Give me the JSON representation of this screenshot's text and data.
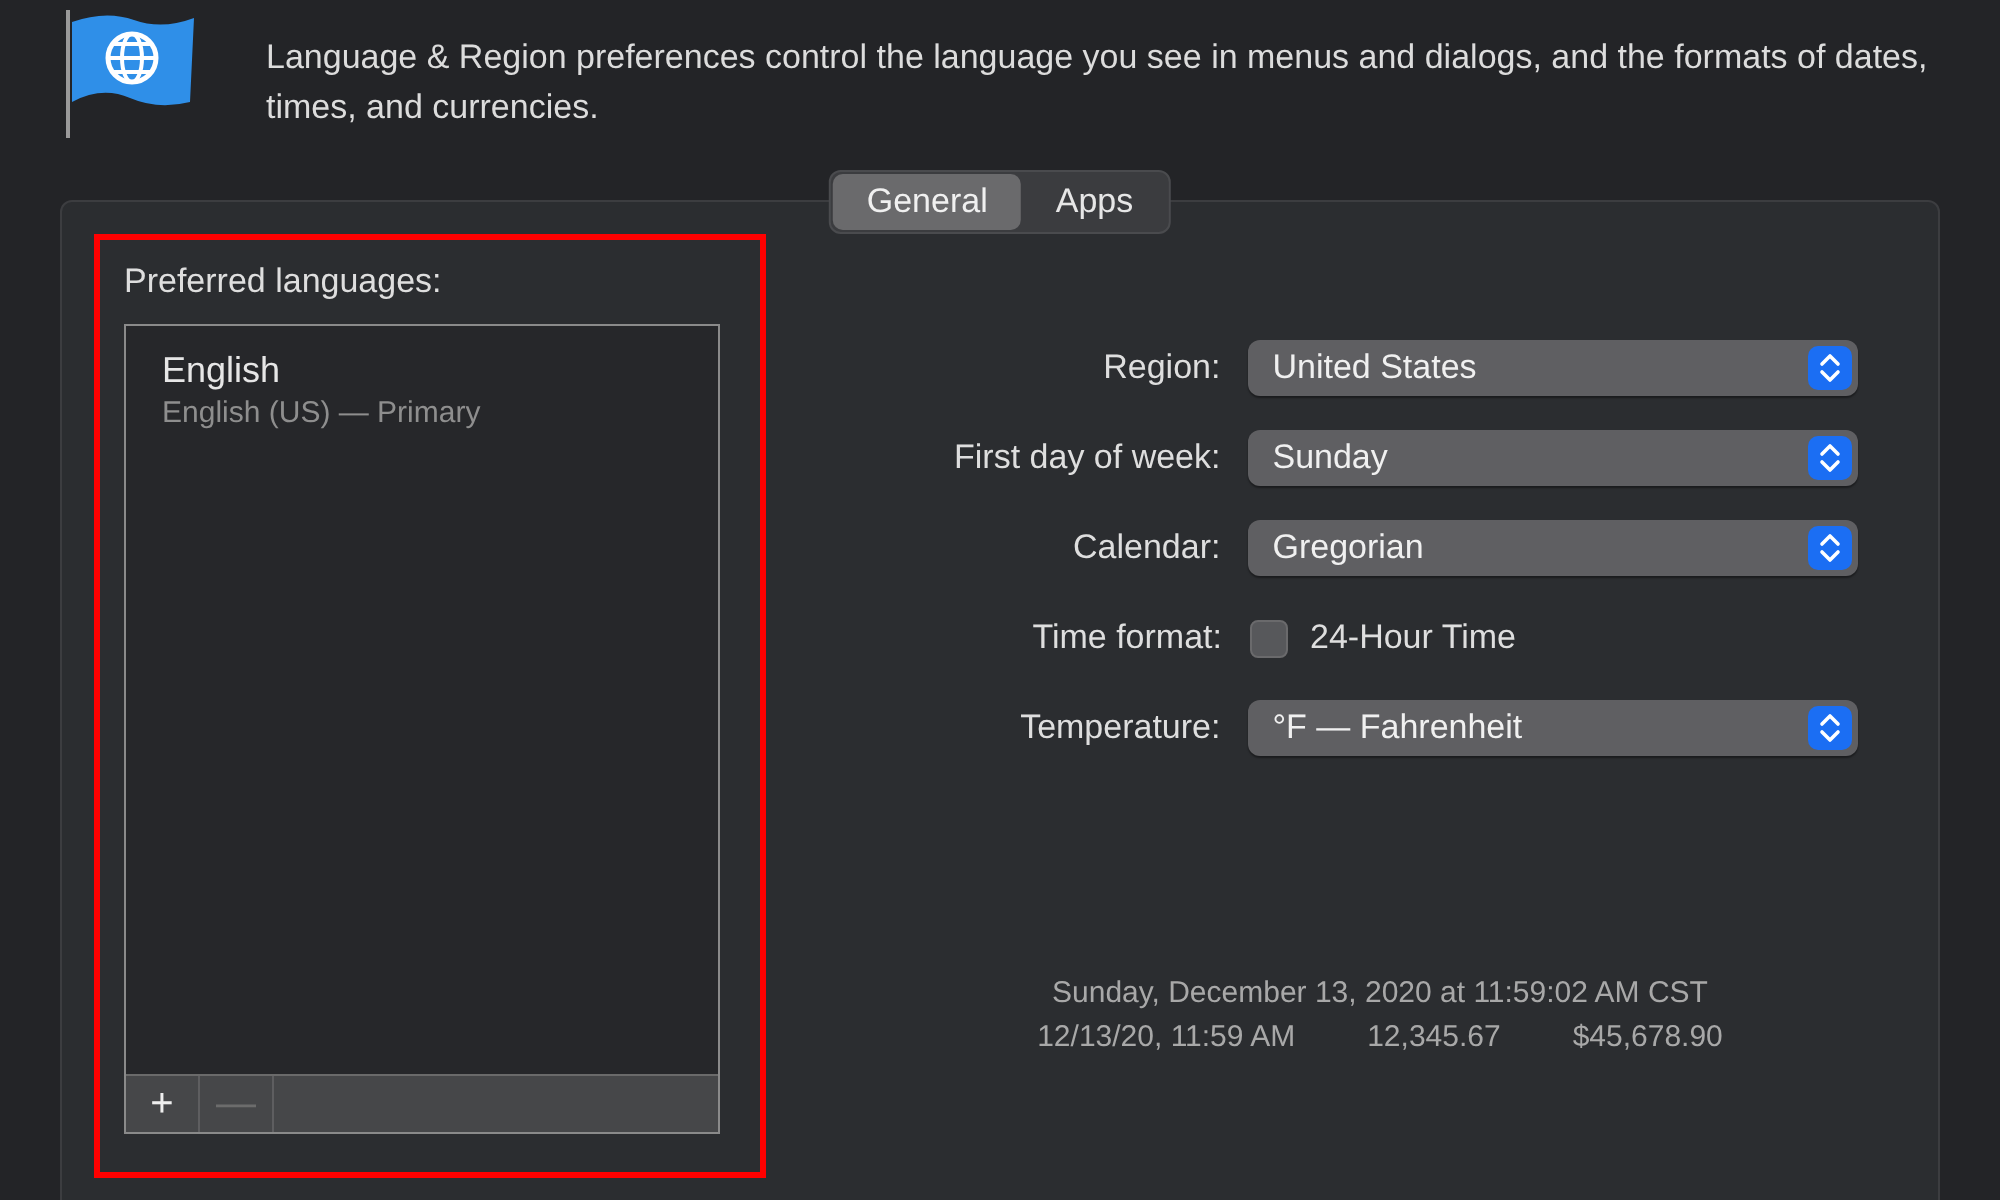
{
  "header": {
    "description": "Language & Region preferences control the language you see in menus and dialogs, and the formats of dates, times, and currencies."
  },
  "tabs": [
    {
      "label": "General",
      "selected": true
    },
    {
      "label": "Apps",
      "selected": false
    }
  ],
  "preferred_languages": {
    "label": "Preferred languages:",
    "items": [
      {
        "name": "English",
        "detail": "English (US) — Primary"
      }
    ],
    "buttons": [
      {
        "label": "+",
        "disabled": false
      },
      {
        "label": "—",
        "disabled": true
      }
    ]
  },
  "settings": [
    {
      "kind": "popup",
      "label": "Region:",
      "value": "United States"
    },
    {
      "kind": "popup",
      "label": "First day of week:",
      "value": "Sunday"
    },
    {
      "kind": "popup",
      "label": "Calendar:",
      "value": "Gregorian"
    },
    {
      "kind": "checkbox",
      "label": "Time format:",
      "option": "24-Hour Time",
      "checked": false
    },
    {
      "kind": "popup",
      "label": "Temperature:",
      "value": "°F — Fahrenheit"
    }
  ],
  "sample": {
    "date_line": "Sunday, December 13, 2020 at 11:59:02 AM CST",
    "values": [
      "12/13/20, 11:59 AM",
      "12,345.67",
      "$45,678.90"
    ]
  }
}
